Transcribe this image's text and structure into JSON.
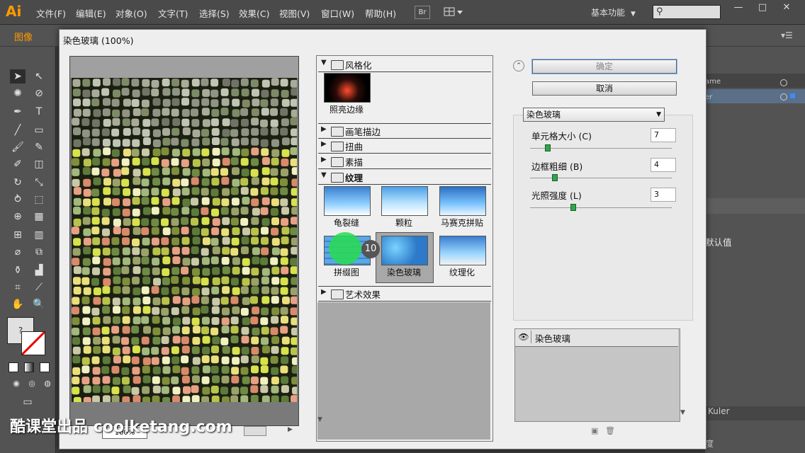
{
  "app": {
    "logo": "Ai",
    "menus": [
      "文件(F)",
      "编辑(E)",
      "对象(O)",
      "文字(T)",
      "选择(S)",
      "效果(C)",
      "视图(V)",
      "窗口(W)",
      "帮助(H)"
    ],
    "br_label": "Br",
    "workspace": "基本功能",
    "search_icon": "⚲",
    "window_controls": [
      "—",
      "□",
      "✕"
    ],
    "document_label": "图像"
  },
  "right_panels": {
    "row1": "ame",
    "row2": "er",
    "default_value": "默认值",
    "kuler": "Kuler",
    "bottom": "度"
  },
  "dialog": {
    "title": "染色玻璃 (100%)",
    "zoom_value": "100%",
    "categories": [
      {
        "label": "风格化",
        "expanded": true
      },
      {
        "label": "画笔描边",
        "expanded": false
      },
      {
        "label": "扭曲",
        "expanded": false
      },
      {
        "label": "素描",
        "expanded": false
      },
      {
        "label": "纹理",
        "expanded": true
      },
      {
        "label": "艺术效果",
        "expanded": false
      }
    ],
    "stylize_filters": [
      "照亮边缘"
    ],
    "texture_filters": [
      "龟裂缝",
      "颗粒",
      "马赛克拼贴",
      "拼缀图",
      "染色玻璃",
      "纹理化"
    ],
    "selected_filter": "染色玻璃",
    "ok_label": "确定",
    "cancel_label": "取消",
    "filter_select_value": "染色玻璃",
    "params": [
      {
        "label": "单元格大小 (C)",
        "value": "7",
        "fraction": 0.12
      },
      {
        "label": "边框粗细 (B)",
        "value": "4",
        "fraction": 0.17
      },
      {
        "label": "光照强度 (L)",
        "value": "3",
        "fraction": 0.3
      }
    ],
    "effect_layer": "染色玻璃"
  },
  "overlay": {
    "click_count": "10",
    "watermark": "酷课堂出品 coolketang.com"
  }
}
